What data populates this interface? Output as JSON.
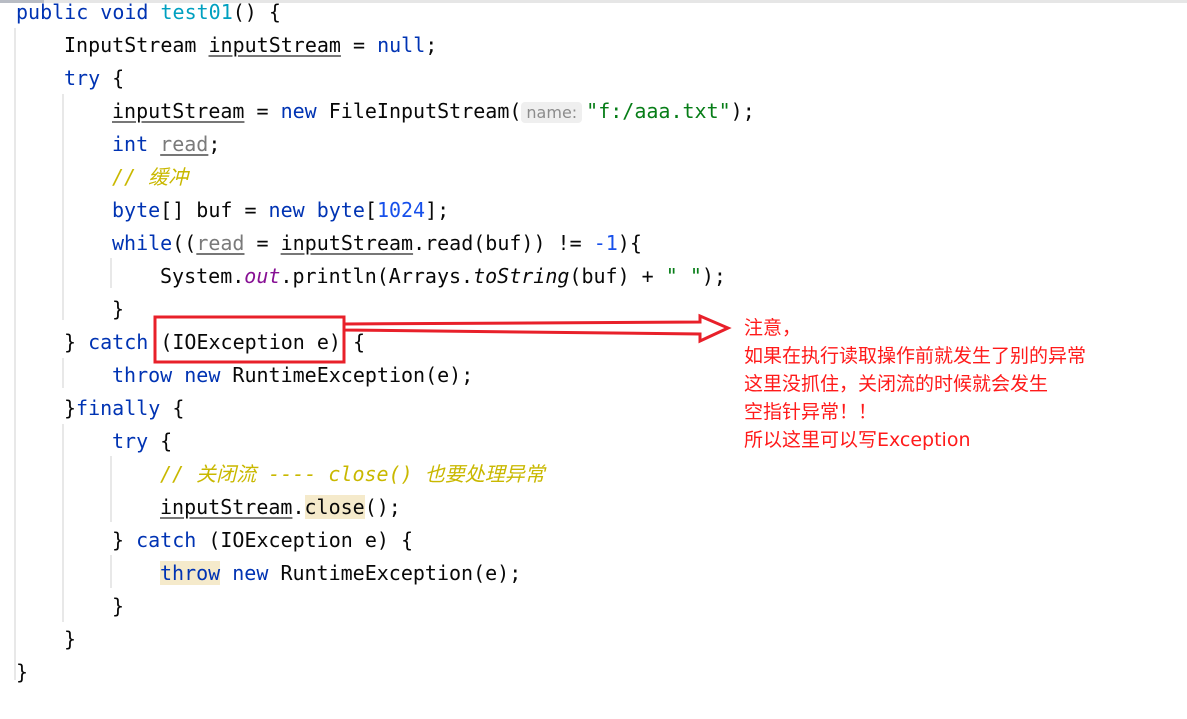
{
  "lines": [
    {
      "indent": 0,
      "tokens": [
        {
          "t": "public ",
          "c": "kw"
        },
        {
          "t": "void ",
          "c": "kw"
        },
        {
          "t": "test01",
          "c": "fn"
        },
        {
          "t": "() {",
          "c": "plain"
        }
      ]
    },
    {
      "indent": 1,
      "tokens": [
        {
          "t": "InputStream ",
          "c": "plain"
        },
        {
          "t": "inputStream",
          "c": "plain u"
        },
        {
          "t": " = ",
          "c": "plain"
        },
        {
          "t": "null",
          "c": "kw"
        },
        {
          "t": ";",
          "c": "plain"
        }
      ]
    },
    {
      "indent": 1,
      "tokens": [
        {
          "t": "try ",
          "c": "kw"
        },
        {
          "t": "{",
          "c": "plain"
        }
      ]
    },
    {
      "indent": 2,
      "tokens": [
        {
          "t": "inputStream",
          "c": "plain u"
        },
        {
          "t": " = ",
          "c": "plain"
        },
        {
          "t": "new ",
          "c": "kw"
        },
        {
          "t": "FileInputStream(",
          "c": "plain"
        },
        {
          "t": "name:",
          "c": "hint"
        },
        {
          "t": "\"f:/aaa.txt\"",
          "c": "str"
        },
        {
          "t": ");",
          "c": "plain"
        }
      ]
    },
    {
      "indent": 2,
      "tokens": [
        {
          "t": "int ",
          "c": "kw"
        },
        {
          "t": "read",
          "c": "gray u"
        },
        {
          "t": ";",
          "c": "plain"
        }
      ]
    },
    {
      "indent": 2,
      "tokens": [
        {
          "t": "// 缓冲",
          "c": "cmt"
        }
      ]
    },
    {
      "indent": 2,
      "tokens": [
        {
          "t": "byte",
          "c": "kw"
        },
        {
          "t": "[] buf = ",
          "c": "plain"
        },
        {
          "t": "new ",
          "c": "kw"
        },
        {
          "t": "byte",
          "c": "kw"
        },
        {
          "t": "[",
          "c": "plain"
        },
        {
          "t": "1024",
          "c": "num"
        },
        {
          "t": "];",
          "c": "plain"
        }
      ]
    },
    {
      "indent": 2,
      "tokens": [
        {
          "t": "while",
          "c": "kw"
        },
        {
          "t": "((",
          "c": "plain"
        },
        {
          "t": "read",
          "c": "gray u"
        },
        {
          "t": " = ",
          "c": "plain"
        },
        {
          "t": "inputStream",
          "c": "plain u"
        },
        {
          "t": ".read(buf)) != ",
          "c": "plain"
        },
        {
          "t": "-1",
          "c": "num"
        },
        {
          "t": "){",
          "c": "plain"
        }
      ]
    },
    {
      "indent": 3,
      "tokens": [
        {
          "t": "System.",
          "c": "plain"
        },
        {
          "t": "out",
          "c": "field"
        },
        {
          "t": ".println(Arrays.",
          "c": "plain"
        },
        {
          "t": "toString",
          "c": "stat"
        },
        {
          "t": "(buf) + ",
          "c": "plain"
        },
        {
          "t": "\" \"",
          "c": "str"
        },
        {
          "t": ");",
          "c": "plain"
        }
      ]
    },
    {
      "indent": 2,
      "tokens": [
        {
          "t": "}",
          "c": "plain"
        }
      ]
    },
    {
      "indent": 1,
      "tokens": [
        {
          "t": "} ",
          "c": "plain"
        },
        {
          "t": "catch ",
          "c": "kw"
        },
        {
          "t": "(IOException e) {",
          "c": "plain"
        }
      ]
    },
    {
      "indent": 2,
      "tokens": [
        {
          "t": "throw ",
          "c": "kw"
        },
        {
          "t": "new ",
          "c": "kw"
        },
        {
          "t": "RuntimeException(e);",
          "c": "plain"
        }
      ]
    },
    {
      "indent": 1,
      "tokens": [
        {
          "t": "}",
          "c": "plain"
        },
        {
          "t": "finally ",
          "c": "kw"
        },
        {
          "t": "{",
          "c": "plain"
        }
      ]
    },
    {
      "indent": 2,
      "tokens": [
        {
          "t": "try ",
          "c": "kw"
        },
        {
          "t": "{",
          "c": "plain"
        }
      ]
    },
    {
      "indent": 3,
      "tokens": [
        {
          "t": "// 关闭流 ---- close() 也要处理异常",
          "c": "cmt"
        }
      ]
    },
    {
      "indent": 3,
      "tokens": [
        {
          "t": "inputStream",
          "c": "plain u"
        },
        {
          "t": ".",
          "c": "plain"
        },
        {
          "t": "close",
          "c": "plain hl"
        },
        {
          "t": "();",
          "c": "plain"
        }
      ]
    },
    {
      "indent": 2,
      "tokens": [
        {
          "t": "} ",
          "c": "plain"
        },
        {
          "t": "catch ",
          "c": "kw"
        },
        {
          "t": "(IOException e) {",
          "c": "plain"
        }
      ]
    },
    {
      "indent": 3,
      "tokens": [
        {
          "t": "throw",
          "c": "kw hl"
        },
        {
          "t": " ",
          "c": "plain"
        },
        {
          "t": "new ",
          "c": "kw"
        },
        {
          "t": "RuntimeException(e);",
          "c": "plain"
        }
      ]
    },
    {
      "indent": 2,
      "tokens": [
        {
          "t": "}",
          "c": "plain"
        }
      ]
    },
    {
      "indent": 1,
      "tokens": [
        {
          "t": "}",
          "c": "plain"
        }
      ]
    },
    {
      "indent": 0,
      "tokens": [
        {
          "t": "}",
          "c": "plain"
        }
      ]
    }
  ],
  "annotation": {
    "lines": [
      "注意，",
      "如果在执行读取操作前就发生了别的异常",
      "这里没抓住，关闭流的时候就会发生",
      "空指针异常！！",
      "所以这里可以写Exception"
    ],
    "color": "#ff1a1a"
  }
}
